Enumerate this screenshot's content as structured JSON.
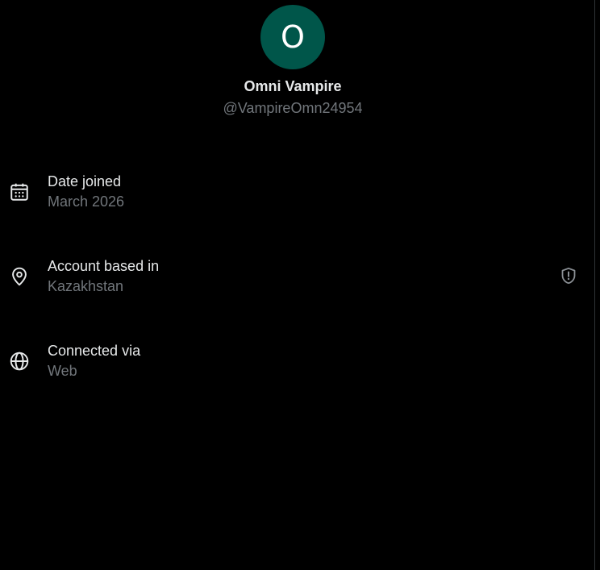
{
  "profile": {
    "avatar_letter": "O",
    "avatar_color": "#00564a",
    "display_name": "Omni Vampire",
    "handle": "@VampireOmn24954"
  },
  "about": [
    {
      "label": "Date joined",
      "value": "March 2026",
      "icon": "calendar-icon"
    },
    {
      "label": "Account based in",
      "value": "Kazakhstan",
      "icon": "location-pin-icon",
      "action_icon": "shield-alert-icon"
    },
    {
      "label": "Connected via",
      "value": "Web",
      "icon": "globe-icon"
    }
  ],
  "colors": {
    "background": "#000000",
    "primary_text": "#e7e9ea",
    "secondary_text": "#71767b"
  }
}
